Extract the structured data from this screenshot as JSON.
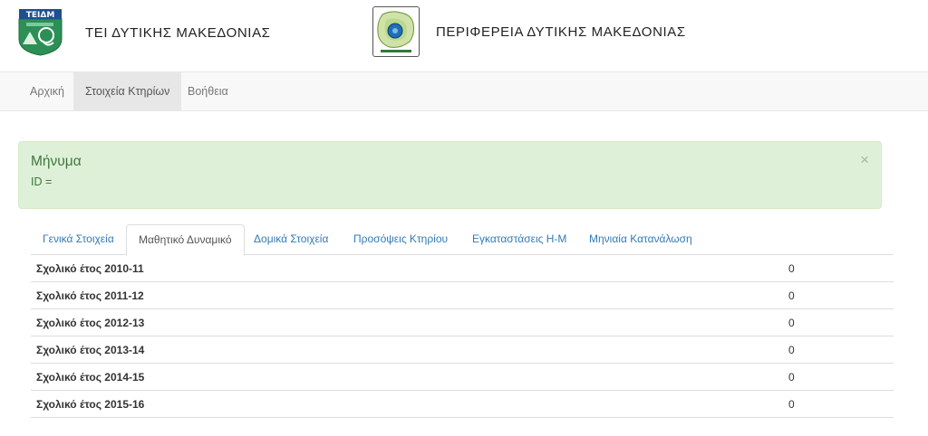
{
  "header": {
    "tei_title": "ΤΕΙ ΔΥΤΙΚΗΣ ΜΑΚΕΔΟΝΙΑΣ",
    "tei_logo_text": "ΤΕΙΔΜ",
    "region_title": "ΠΕΡΙΦΕΡΕΙΑ ΔΥΤΙΚΗΣ ΜΑΚΕΔΟΝΙΑΣ"
  },
  "navbar": {
    "items": [
      {
        "label": "Αρχική"
      },
      {
        "label": "Στοιχεία Κτηρίων"
      },
      {
        "label": "Βοήθεια"
      }
    ],
    "active_index": 1
  },
  "alert": {
    "title": "Μήνυμα",
    "body": "ID =",
    "close_symbol": "×"
  },
  "tabs": {
    "items": [
      {
        "label": "Γενικά Στοιχεία"
      },
      {
        "label": "Μαθητικό Δυναμικό"
      },
      {
        "label": "Δομικά Στοιχεία"
      },
      {
        "label": "Προσόψεις Κτηρίου"
      },
      {
        "label": "Εγκαταστάσεις Η-Μ"
      },
      {
        "label": "Μηνιαία Κατανάλωση"
      }
    ],
    "active_index": 1
  },
  "table": {
    "rows": [
      {
        "label": "Σχολικό έτος 2010-11",
        "value": "0"
      },
      {
        "label": "Σχολικό έτος 2011-12",
        "value": "0"
      },
      {
        "label": "Σχολικό έτος 2012-13",
        "value": "0"
      },
      {
        "label": "Σχολικό έτος 2013-14",
        "value": "0"
      },
      {
        "label": "Σχολικό έτος 2014-15",
        "value": "0"
      },
      {
        "label": "Σχολικό έτος 2015-16",
        "value": "0"
      }
    ]
  },
  "colors": {
    "alert_background": "#dff0d8",
    "alert_text": "#3c763d",
    "link": "#337ab7",
    "navbar_background": "#f8f8f8"
  }
}
